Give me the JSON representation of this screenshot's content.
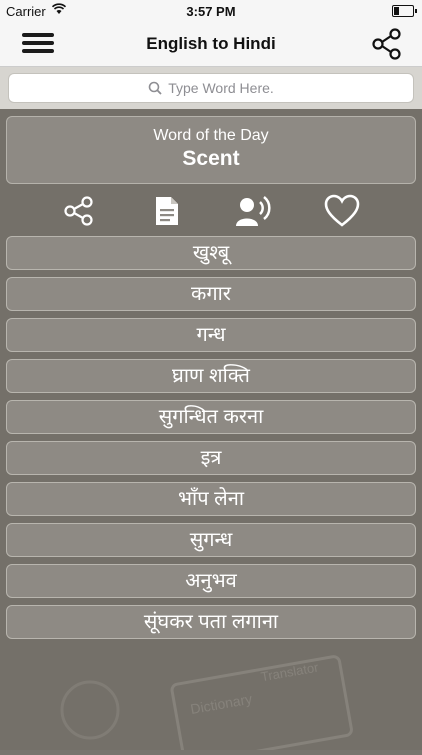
{
  "status": {
    "carrier": "Carrier",
    "time": "3:57 PM",
    "battery_level": 0.3
  },
  "nav": {
    "title": "English to Hindi"
  },
  "search": {
    "placeholder": "Type Word Here."
  },
  "word_of_day": {
    "label": "Word of the Day",
    "word": "Scent"
  },
  "translations": [
    "खुश्बू",
    "कगार",
    "गन्ध",
    "घ्राण शक्ति",
    "सुगन्धित करना",
    "इत्र",
    "भाँप लेना",
    "सुगन्ध",
    "अनुभव",
    "सूंघकर पता लगाना"
  ],
  "background_marks": {
    "dictionary": "Dictionary",
    "translator": "Translator"
  },
  "icons": {
    "menu": "hamburger-menu-icon",
    "share": "share-icon",
    "search": "search-icon",
    "actions": [
      "share-icon",
      "document-icon",
      "speaker-icon",
      "heart-icon"
    ]
  }
}
